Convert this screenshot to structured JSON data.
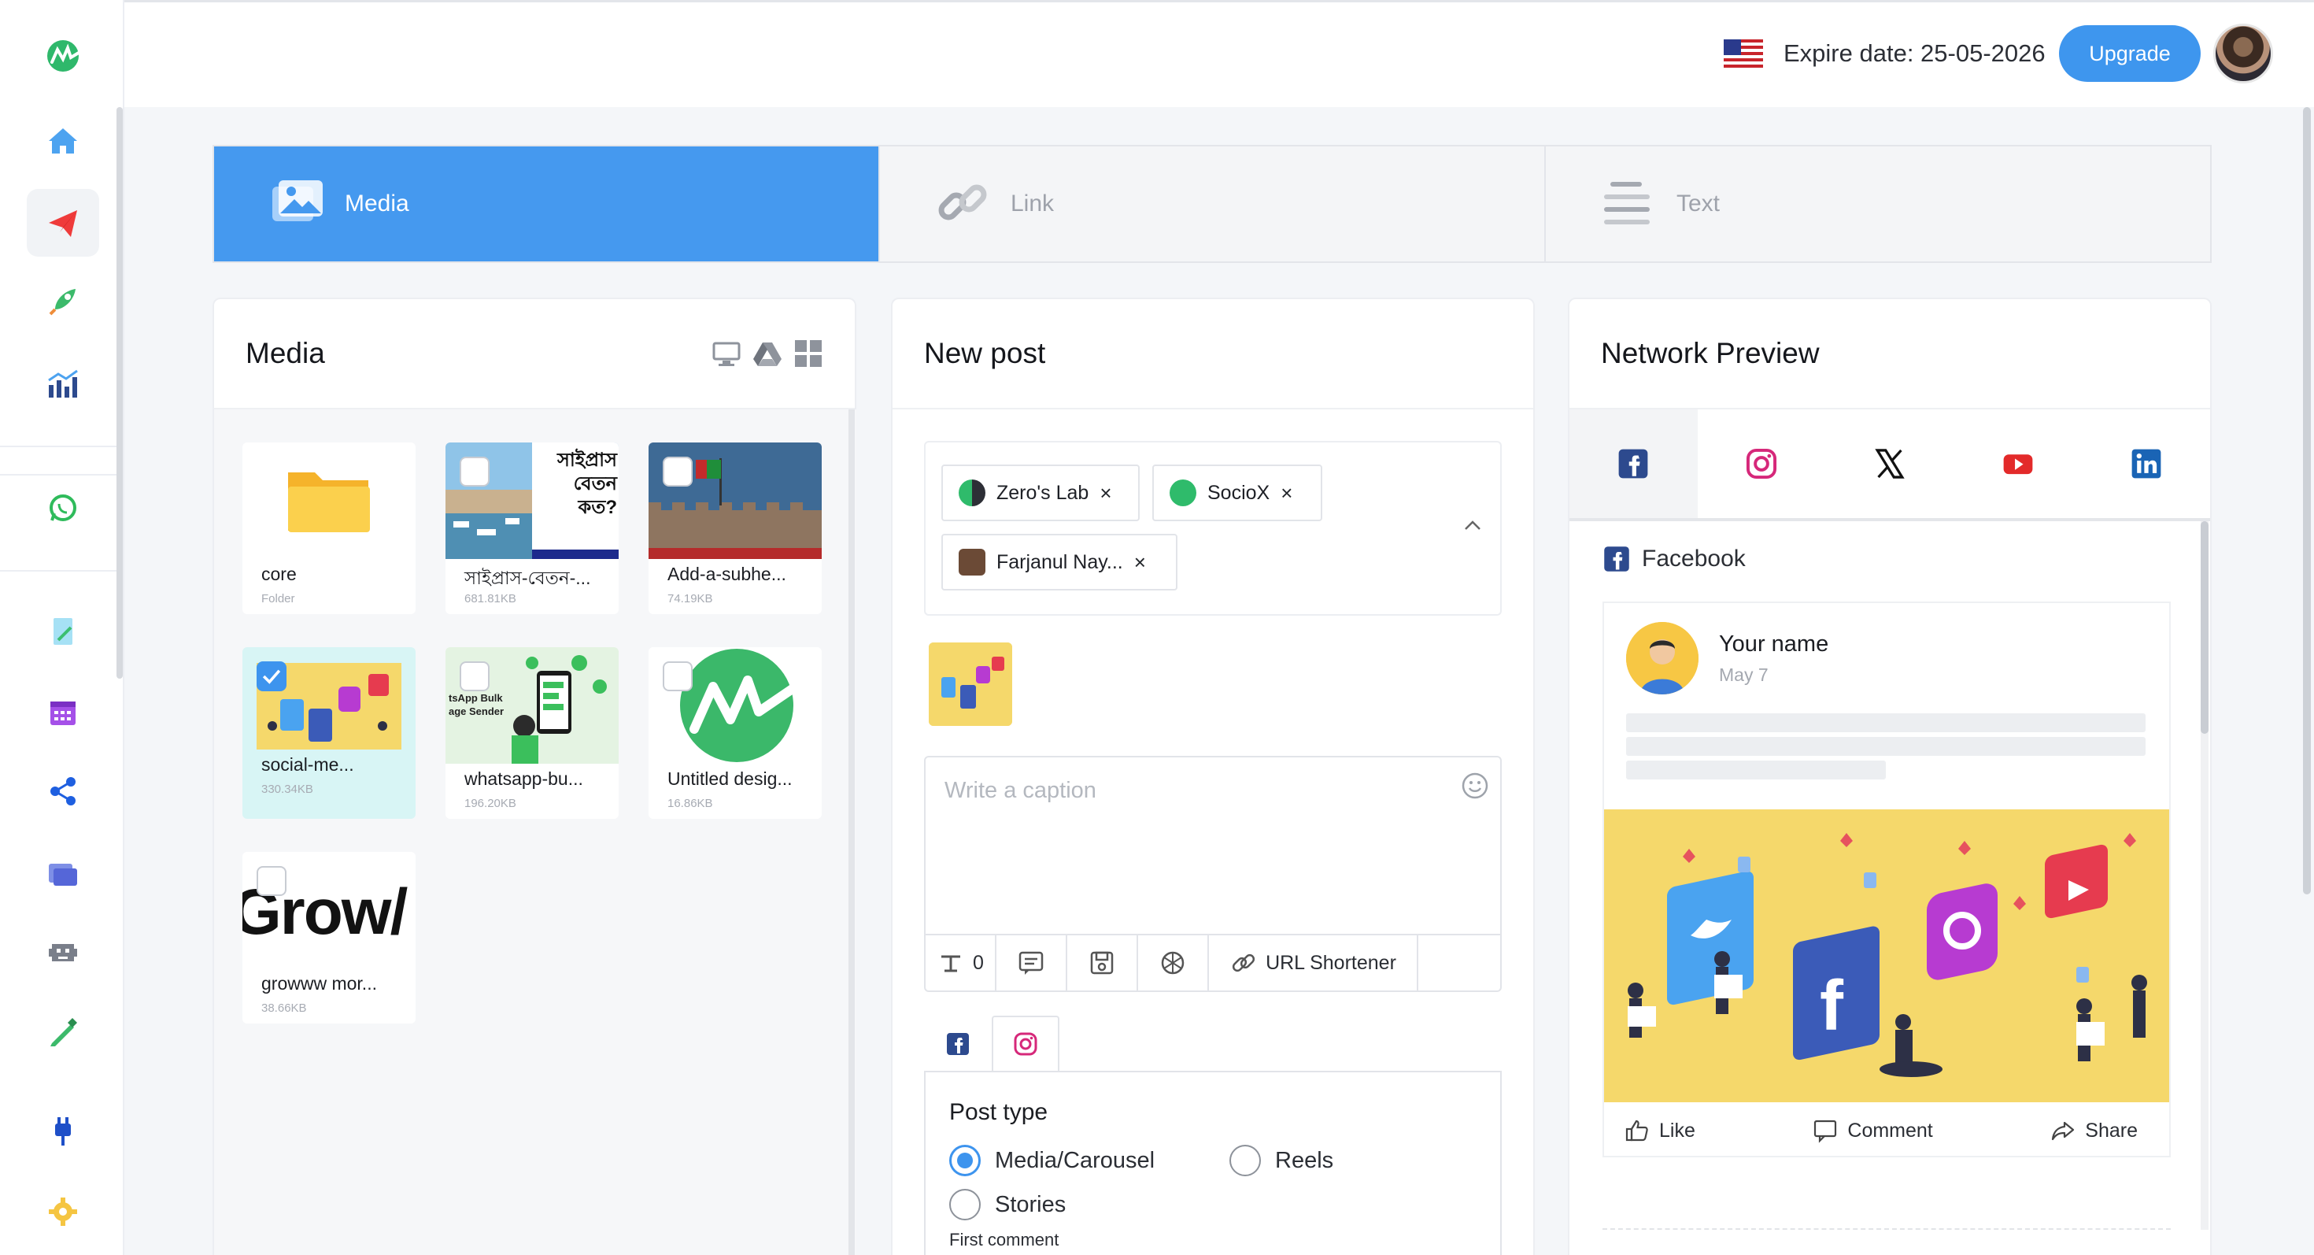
{
  "header": {
    "expire_text": "Expire date: 25-05-2026",
    "upgrade_label": "Upgrade"
  },
  "tabs": [
    {
      "label": "Media",
      "icon": "image-icon",
      "active": true
    },
    {
      "label": "Link",
      "icon": "link-icon",
      "active": false
    },
    {
      "label": "Text",
      "icon": "text-lines-icon",
      "active": false
    }
  ],
  "media": {
    "title": "Media",
    "items": [
      {
        "name": "core",
        "meta": "Folder",
        "type": "folder",
        "checked": false
      },
      {
        "name": "সাইপ্রাস-বেতন-...",
        "meta": "681.81KB",
        "type": "image",
        "checked": false,
        "overlay_text": "সাইপ্রাস বেতন কত?"
      },
      {
        "name": "Add-a-subhe...",
        "meta": "74.19KB",
        "type": "image",
        "checked": false
      },
      {
        "name": "social-me...",
        "meta": "330.34KB",
        "type": "image",
        "checked": true
      },
      {
        "name": "whatsapp-bu...",
        "meta": "196.20KB",
        "type": "image",
        "checked": false,
        "overlay_text": "tsApp Bulk age Sender"
      },
      {
        "name": "Untitled desig...",
        "meta": "16.86KB",
        "type": "image",
        "checked": false
      },
      {
        "name": "growww mor...",
        "meta": "38.66KB",
        "type": "image",
        "checked": false,
        "overlay_text": "Grow/"
      }
    ]
  },
  "post": {
    "title": "New post",
    "accounts": [
      {
        "name": "Zero's Lab",
        "remove": "×"
      },
      {
        "name": "SocioX",
        "remove": "×"
      },
      {
        "name": "Farjanul Nay...",
        "remove": "×"
      }
    ],
    "caption_placeholder": "Write a caption",
    "toolbar": {
      "count": "0",
      "url_shortener": "URL Shortener"
    },
    "post_type": {
      "title": "Post type",
      "options": [
        {
          "label": "Media/Carousel",
          "selected": true
        },
        {
          "label": "Reels",
          "selected": false
        },
        {
          "label": "Stories",
          "selected": false
        }
      ]
    },
    "first_comment_label": "First comment"
  },
  "preview": {
    "title": "Network Preview",
    "networks": [
      "facebook-icon",
      "instagram-icon",
      "x-icon",
      "youtube-icon",
      "linkedin-icon"
    ],
    "active_network_label": "Facebook",
    "fb_post": {
      "name": "Your name",
      "date": "May 7",
      "actions": [
        "Like",
        "Comment",
        "Share"
      ]
    }
  },
  "colors": {
    "accent": "#4599ef",
    "sidebar_active": "#ef3b3b"
  }
}
